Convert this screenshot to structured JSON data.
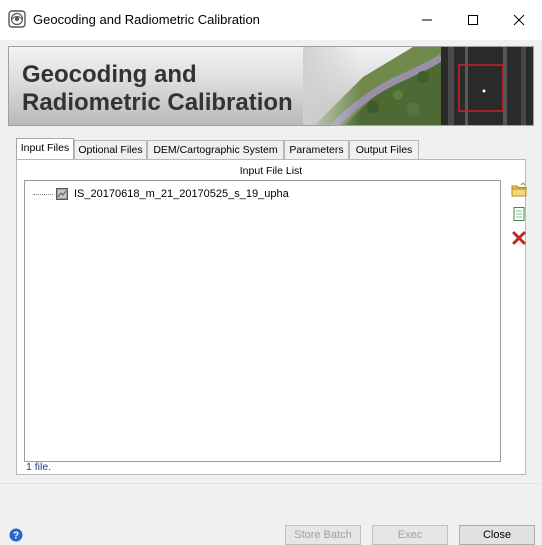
{
  "window": {
    "title": "Geocoding and Radiometric Calibration"
  },
  "banner": {
    "title": "Geocoding and Radiometric Calibration"
  },
  "tabs": [
    {
      "label": "Input Files",
      "active": true
    },
    {
      "label": "Optional Files",
      "active": false
    },
    {
      "label": "DEM/Cartographic System",
      "active": false
    },
    {
      "label": "Parameters",
      "active": false
    },
    {
      "label": "Output Files",
      "active": false
    }
  ],
  "input_files": {
    "list_title": "Input File List",
    "items": [
      {
        "name": "IS_20170618_m_21_20170525_s_19_upha"
      }
    ],
    "count_label": "1 file."
  },
  "buttons": {
    "store_batch": "Store Batch",
    "exec": "Exec",
    "close": "Close"
  },
  "colors": {
    "delete_icon": "#c0261d",
    "count_text": "#1a3c8c",
    "help_icon": "#2a66c8"
  }
}
